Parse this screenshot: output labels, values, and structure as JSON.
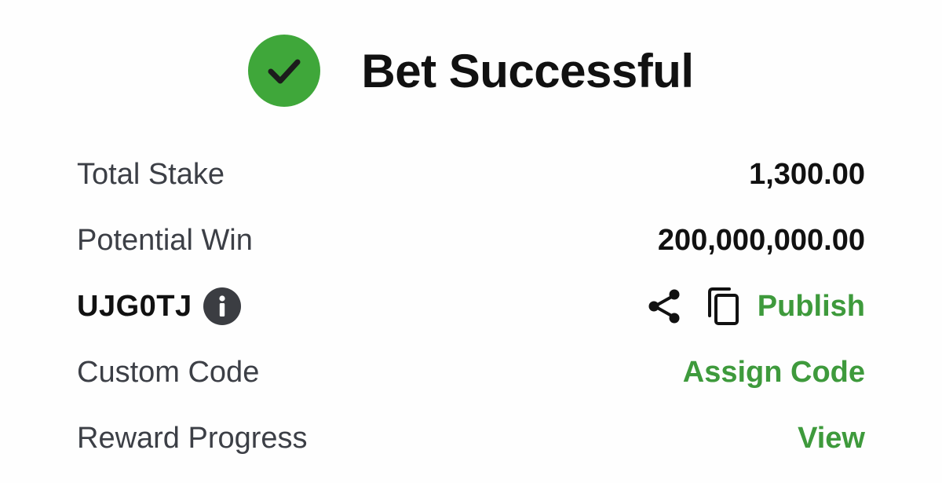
{
  "header": {
    "title": "Bet Successful",
    "icon": "check-circle-icon",
    "accent_color": "#3fa73a"
  },
  "rows": {
    "total_stake": {
      "label": "Total Stake",
      "value": "1,300.00"
    },
    "potential_win": {
      "label": "Potential Win",
      "value": "200,000,000.00"
    },
    "booking": {
      "code": "UJG0TJ",
      "info_icon": "info-icon",
      "share_icon": "share-icon",
      "copy_icon": "copy-icon",
      "publish_label": "Publish"
    },
    "custom_code": {
      "label": "Custom Code",
      "action_label": "Assign Code"
    },
    "reward_progress": {
      "label": "Reward Progress",
      "action_label": "View"
    }
  },
  "colors": {
    "link_green": "#3e9a3c",
    "text_dark": "#111111",
    "text_label": "#3c3f46"
  }
}
